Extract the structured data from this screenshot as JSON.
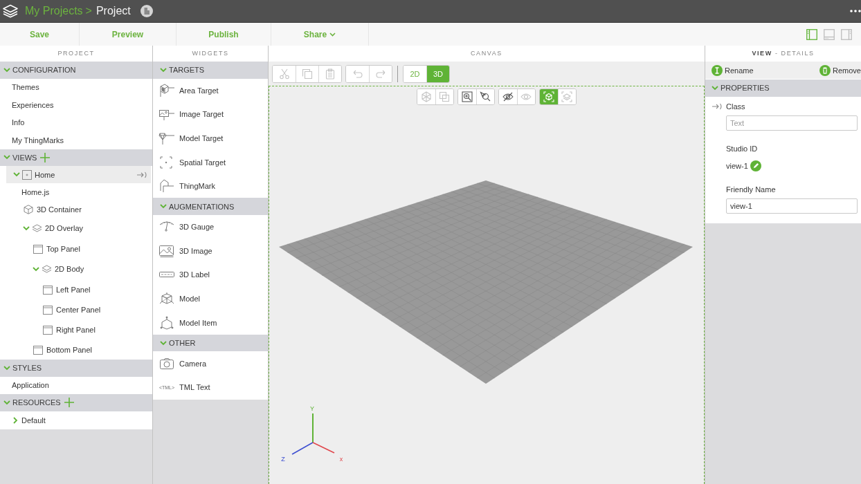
{
  "top_bar": {
    "breadcrumb": [
      {
        "label": "My Projects",
        "current": false
      },
      {
        "label": "Project",
        "current": true
      }
    ],
    "separator": ">"
  },
  "toolbar": {
    "buttons": [
      {
        "label": "Save",
        "dropdown": false
      },
      {
        "label": "Preview",
        "dropdown": false
      },
      {
        "label": "Publish",
        "dropdown": false
      },
      {
        "label": "Share",
        "dropdown": true
      }
    ],
    "layout_toggles": [
      {
        "kind": "left",
        "on": true
      },
      {
        "kind": "bottom",
        "on": false
      },
      {
        "kind": "right",
        "on": false
      }
    ]
  },
  "project_panel": {
    "title": "PROJECT",
    "sections": [
      {
        "title": "CONFIGURATION",
        "expanded": true,
        "add_button": false,
        "items": [
          {
            "label": "Themes",
            "selected": false
          },
          {
            "label": "Experiences",
            "selected": false
          },
          {
            "label": "Info",
            "selected": false
          },
          {
            "label": "My ThingMarks",
            "selected": false
          }
        ]
      },
      {
        "title": "VIEWS",
        "expanded": true,
        "add_button": true,
        "items": [
          {
            "label": "Home",
            "kind": "view",
            "expanded": true,
            "selected": true,
            "binding": true,
            "children": [
              {
                "label": "Home.js",
                "kind": "script",
                "selected": false
              },
              {
                "label": "3D Container",
                "kind": "container",
                "selected": false
              },
              {
                "label": "2D Overlay",
                "kind": "layer",
                "expanded": true,
                "selected": false,
                "children": [
                  {
                    "label": "Top Panel",
                    "kind": "panel",
                    "selected": false
                  },
                  {
                    "label": "2D Body",
                    "kind": "layer",
                    "expanded": true,
                    "selected": false,
                    "children": [
                      {
                        "label": "Left Panel",
                        "kind": "panel",
                        "selected": false
                      },
                      {
                        "label": "Center Panel",
                        "kind": "panel",
                        "selected": false
                      },
                      {
                        "label": "Right Panel",
                        "kind": "panel",
                        "selected": false
                      }
                    ]
                  },
                  {
                    "label": "Bottom Panel",
                    "kind": "panel",
                    "selected": false
                  }
                ]
              }
            ]
          }
        ]
      },
      {
        "title": "STYLES",
        "expanded": true,
        "add_button": false,
        "items": [
          {
            "label": "Application",
            "selected": false
          }
        ]
      },
      {
        "title": "RESOURCES",
        "expanded": true,
        "add_button": true,
        "items": [
          {
            "label": "Default",
            "kind": "folder",
            "expanded": false,
            "selected": false
          }
        ]
      }
    ]
  },
  "widgets_panel": {
    "title": "WIDGETS",
    "sections": [
      {
        "title": "TARGETS",
        "expanded": true,
        "items": [
          {
            "label": "Area Target",
            "kind": "area-target"
          },
          {
            "label": "Image Target",
            "kind": "image-target"
          },
          {
            "label": "Model Target",
            "kind": "model-target"
          },
          {
            "label": "Spatial Target",
            "kind": "spatial-target"
          },
          {
            "label": "ThingMark",
            "kind": "thingmark"
          }
        ]
      },
      {
        "title": "AUGMENTATIONS",
        "expanded": true,
        "items": [
          {
            "label": "3D Gauge",
            "kind": "gauge"
          },
          {
            "label": "3D Image",
            "kind": "image"
          },
          {
            "label": "3D Label",
            "kind": "label"
          },
          {
            "label": "Model",
            "kind": "model"
          },
          {
            "label": "Model Item",
            "kind": "model-item"
          }
        ]
      },
      {
        "title": "OTHER",
        "expanded": true,
        "items": [
          {
            "label": "Camera",
            "kind": "camera"
          },
          {
            "label": "TML Text",
            "kind": "tml",
            "tag": "<TML>"
          }
        ]
      }
    ]
  },
  "canvas_panel": {
    "title": "CANVAS",
    "edit_groups": [
      {
        "tools": [
          {
            "kind": "cut",
            "disabled": true
          },
          {
            "kind": "copy",
            "disabled": true
          },
          {
            "kind": "paste",
            "disabled": true
          }
        ]
      },
      {
        "tools": [
          {
            "kind": "undo",
            "disabled": true
          },
          {
            "kind": "redo",
            "disabled": true
          }
        ]
      }
    ],
    "mode_toggle": [
      {
        "label": "2D",
        "selected": false
      },
      {
        "label": "3D",
        "selected": true
      }
    ],
    "view_groups": [
      {
        "tools": [
          {
            "kind": "cube",
            "disabled": true,
            "selected": false
          },
          {
            "kind": "overlay",
            "disabled": true,
            "selected": false
          }
        ]
      },
      {
        "tools": [
          {
            "kind": "zoom-fit",
            "disabled": false,
            "selected": false
          },
          {
            "kind": "zoom-select",
            "disabled": false,
            "selected": false
          }
        ]
      },
      {
        "tools": [
          {
            "kind": "hide",
            "disabled": false,
            "selected": false
          },
          {
            "kind": "show",
            "disabled": true,
            "selected": false
          }
        ]
      },
      {
        "tools": [
          {
            "kind": "target",
            "disabled": false,
            "selected": true
          },
          {
            "kind": "layers",
            "disabled": true,
            "selected": false
          }
        ]
      }
    ],
    "axes": [
      {
        "label": "Y",
        "kind": "y",
        "color": "#5fb336"
      },
      {
        "label": "Z",
        "kind": "z",
        "color": "#3d4fd1"
      },
      {
        "label": "x",
        "kind": "x",
        "color": "#e0474c"
      }
    ]
  },
  "details_panel": {
    "title": "**VIEW** - DETAILS",
    "actions": [
      {
        "label": "Rename",
        "kind": "rename"
      },
      {
        "label": "Remove",
        "kind": "remove"
      }
    ],
    "sections": [
      {
        "title": "PROPERTIES",
        "expanded": true,
        "fields": [
          {
            "label": "Class",
            "kind": "text",
            "binding": true,
            "placeholder": "Text"
          },
          {
            "label": "Studio ID",
            "kind": "readonly",
            "value": "view-1",
            "editable": true
          },
          {
            "label": "Friendly Name",
            "kind": "text",
            "binding": false,
            "value": "view-1"
          }
        ]
      }
    ]
  }
}
